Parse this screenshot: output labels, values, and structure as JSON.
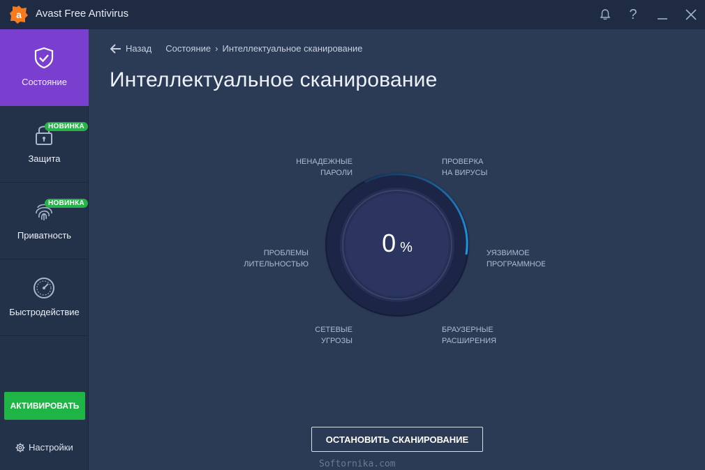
{
  "window": {
    "title": "Avast Free Antivirus",
    "logo_letter": "a"
  },
  "titlebar": {
    "icons": [
      "bell-icon",
      "help-icon",
      "minimize-icon",
      "close-icon"
    ],
    "help_glyph": "?"
  },
  "sidebar": {
    "items": [
      {
        "label": "Состояние",
        "icon": "shield-check-icon",
        "active": true
      },
      {
        "label": "Защита",
        "icon": "lock-icon",
        "badge": "НОВИНКА"
      },
      {
        "label": "Приватность",
        "icon": "fingerprint-icon",
        "badge": "НОВИНКА"
      },
      {
        "label": "Быстродействие",
        "icon": "speedometer-icon"
      }
    ],
    "activate_label": "АКТИВИРОВАТЬ",
    "settings_label": "Настройки"
  },
  "breadcrumb": {
    "back_label": "Назад",
    "parent": "Состояние",
    "separator": "›",
    "current": "Интеллектуальное сканирование"
  },
  "main": {
    "title": "Интеллектуальное сканирование",
    "progress_value": "0",
    "progress_symbol": "%",
    "progress_fraction": 0,
    "scan_items": [
      {
        "line1": "НЕНАДЕЖНЫЕ",
        "line2": "ПАРОЛИ"
      },
      {
        "line1": "ПРОВЕРКА",
        "line2": "НА ВИРУСЫ"
      },
      {
        "line1": "ПРОБЛЕМЫ",
        "line2": "ЛИТЕЛЬНОСТЬЮ"
      },
      {
        "line1": "УЯЗВИМОЕ",
        "line2": "ПРОГРАММНОЕ О"
      },
      {
        "line1": "СЕТЕВЫЕ",
        "line2": "УГРОЗЫ"
      },
      {
        "line1": "БРАУЗЕРНЫЕ",
        "line2": "РАСШИРЕНИЯ"
      }
    ],
    "stop_button_label": "ОСТАНОВИТЬ СКАНИРОВАНИЕ"
  },
  "watermark": "Softornika.com",
  "colors": {
    "background": "#2b3a55",
    "sidebar": "#233149",
    "active_item": "#7b3fd0",
    "badge": "#27b24a",
    "activate_button": "#1fb446",
    "gauge_accent": "#1e9be6",
    "logo": "#f47b20"
  }
}
